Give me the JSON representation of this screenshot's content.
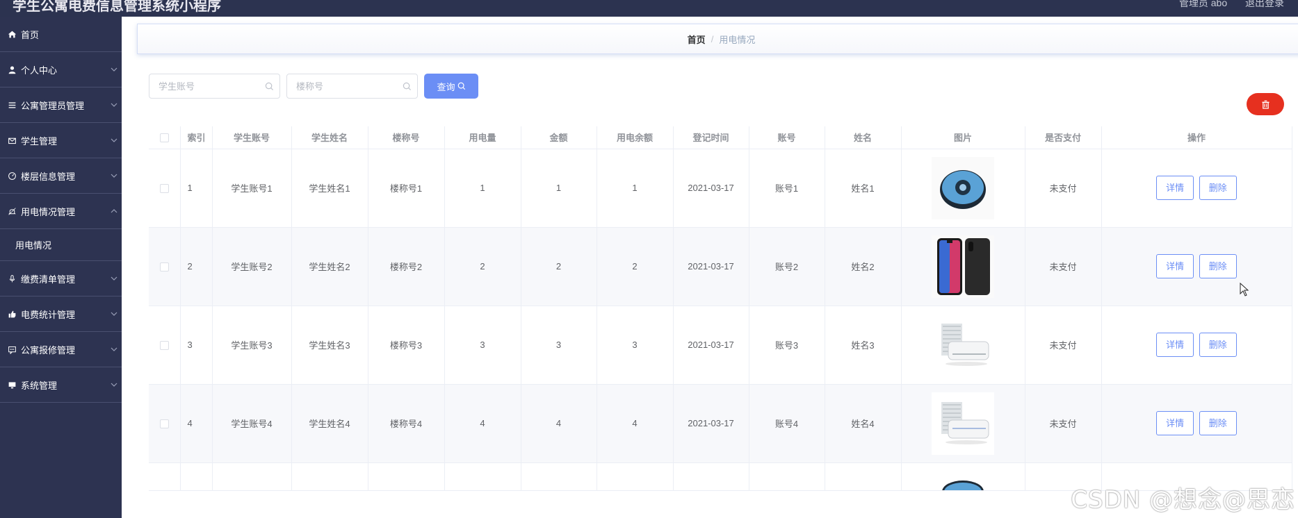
{
  "app": {
    "title": "学生公寓电费信息管理系统小程序",
    "user_label": "管理员 abo",
    "logout": "退出登录"
  },
  "sidebar": {
    "items": [
      {
        "label": "首页",
        "icon": "home-icon"
      },
      {
        "label": "个人中心",
        "icon": "user-icon"
      },
      {
        "label": "公寓管理员管理",
        "icon": "list-icon"
      },
      {
        "label": "学生管理",
        "icon": "mail-icon"
      },
      {
        "label": "楼层信息管理",
        "icon": "dashboard-icon"
      },
      {
        "label": "用电情况管理",
        "icon": "bell-icon",
        "expanded": true,
        "children": [
          "用电情况"
        ]
      },
      {
        "label": "缴费清单管理",
        "icon": "mic-icon"
      },
      {
        "label": "电费统计管理",
        "icon": "thumb-icon"
      },
      {
        "label": "公寓报修管理",
        "icon": "message-icon"
      },
      {
        "label": "系统管理",
        "icon": "monitor-icon"
      }
    ]
  },
  "breadcrumb": {
    "home": "首页",
    "sep": "/",
    "current": "用电情况"
  },
  "search": {
    "account_placeholder": "学生账号",
    "building_placeholder": "楼称号",
    "query_label": "查询"
  },
  "table": {
    "headers": [
      "索引",
      "学生账号",
      "学生姓名",
      "楼称号",
      "用电量",
      "金额",
      "用电余额",
      "登记时间",
      "账号",
      "姓名",
      "图片",
      "是否支付",
      "操作"
    ],
    "rows": [
      {
        "index": "1",
        "account": "学生账号1",
        "name": "学生姓名1",
        "building": "楼称号1",
        "usage": "1",
        "amount": "1",
        "balance": "1",
        "date": "2021-03-17",
        "acc": "账号1",
        "pname": "姓名1",
        "image": "robot-vacuum",
        "paid": "未支付",
        "detail": "详情",
        "delete": "删除"
      },
      {
        "index": "2",
        "account": "学生账号2",
        "name": "学生姓名2",
        "building": "楼称号2",
        "usage": "2",
        "amount": "2",
        "balance": "2",
        "date": "2021-03-17",
        "acc": "账号2",
        "pname": "姓名2",
        "image": "smartphone",
        "paid": "未支付",
        "detail": "详情",
        "delete": "删除"
      },
      {
        "index": "3",
        "account": "学生账号3",
        "name": "学生姓名3",
        "building": "楼称号3",
        "usage": "3",
        "amount": "3",
        "balance": "3",
        "date": "2021-03-17",
        "acc": "账号3",
        "pname": "姓名3",
        "image": "air-conditioner",
        "paid": "未支付",
        "detail": "详情",
        "delete": "删除"
      },
      {
        "index": "4",
        "account": "学生账号4",
        "name": "学生姓名4",
        "building": "楼称号4",
        "usage": "4",
        "amount": "4",
        "balance": "4",
        "date": "2021-03-17",
        "acc": "账号4",
        "pname": "姓名4",
        "image": "air-conditioner",
        "paid": "未支付",
        "detail": "详情",
        "delete": "删除"
      }
    ]
  },
  "watermark": "CSDN @想念@思恋",
  "colors": {
    "sidebar": "#2d3351",
    "topbar": "#2c3350",
    "primary": "#6b8ef5",
    "danger": "#e6301f"
  }
}
